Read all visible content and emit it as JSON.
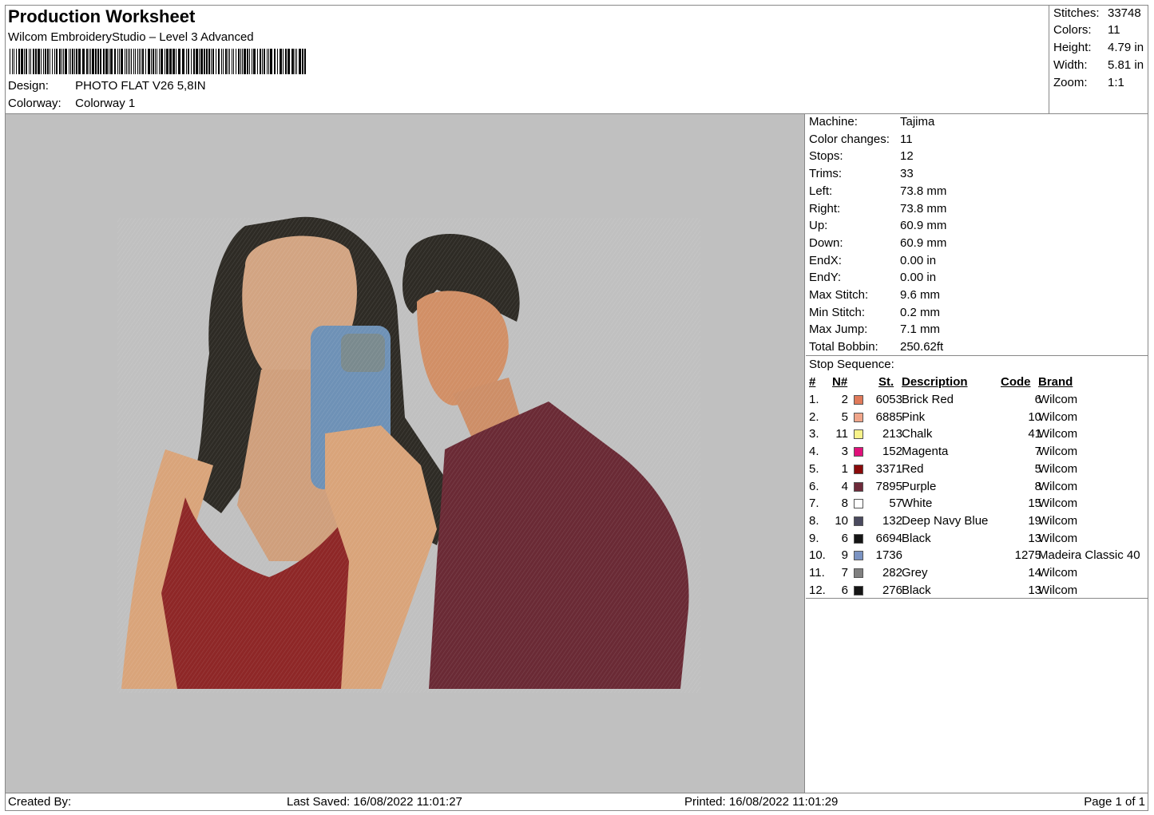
{
  "header": {
    "title": "Production Worksheet",
    "software": "Wilcom EmbroideryStudio – Level 3 Advanced",
    "design_label": "Design:",
    "design_value": "PHOTO FLAT V26 5,8IN",
    "colorway_label": "Colorway:",
    "colorway_value": "Colorway 1"
  },
  "stats": {
    "stitches_label": "Stitches:",
    "stitches_value": "33748",
    "colors_label": "Colors:",
    "colors_value": "11",
    "height_label": "Height:",
    "height_value": "4.79 in",
    "width_label": "Width:",
    "width_value": "5.81 in",
    "zoom_label": "Zoom:",
    "zoom_value": "1:1"
  },
  "machine": [
    {
      "label": "Machine:",
      "value": "Tajima"
    },
    {
      "label": "Color changes:",
      "value": "11"
    },
    {
      "label": "Stops:",
      "value": "12"
    },
    {
      "label": "Trims:",
      "value": "33"
    },
    {
      "label": "Left:",
      "value": "73.8 mm"
    },
    {
      "label": "Right:",
      "value": "73.8 mm"
    },
    {
      "label": "Up:",
      "value": "60.9 mm"
    },
    {
      "label": "Down:",
      "value": "60.9 mm"
    },
    {
      "label": "EndX:",
      "value": "0.00 in"
    },
    {
      "label": "EndY:",
      "value": "0.00 in"
    },
    {
      "label": "Max Stitch:",
      "value": "9.6 mm"
    },
    {
      "label": "Min Stitch:",
      "value": "0.2 mm"
    },
    {
      "label": "Max Jump:",
      "value": "7.1 mm"
    },
    {
      "label": "Total Bobbin:",
      "value": "250.62ft"
    }
  ],
  "stop_sequence": {
    "heading": "Stop Sequence:",
    "columns": {
      "idx": "#",
      "n": "N#",
      "st": "St.",
      "desc": "Description",
      "code": "Code",
      "brand": "Brand"
    },
    "rows": [
      {
        "idx": "1.",
        "n": "2",
        "color": "#e07a5a",
        "st": "6053",
        "desc": "Brick Red",
        "code": "6",
        "brand": "Wilcom"
      },
      {
        "idx": "2.",
        "n": "5",
        "color": "#f0a58a",
        "st": "6885",
        "desc": "Pink",
        "code": "10",
        "brand": "Wilcom"
      },
      {
        "idx": "3.",
        "n": "11",
        "color": "#f7f28a",
        "st": "213",
        "desc": "Chalk",
        "code": "41",
        "brand": "Wilcom"
      },
      {
        "idx": "4.",
        "n": "3",
        "color": "#e0107a",
        "st": "152",
        "desc": "Magenta",
        "code": "7",
        "brand": "Wilcom"
      },
      {
        "idx": "5.",
        "n": "1",
        "color": "#8a0a0a",
        "st": "3371",
        "desc": "Red",
        "code": "5",
        "brand": "Wilcom"
      },
      {
        "idx": "6.",
        "n": "4",
        "color": "#6e2a3a",
        "st": "7895",
        "desc": "Purple",
        "code": "8",
        "brand": "Wilcom"
      },
      {
        "idx": "7.",
        "n": "8",
        "color": "#ffffff",
        "st": "57",
        "desc": "White",
        "code": "15",
        "brand": "Wilcom"
      },
      {
        "idx": "8.",
        "n": "10",
        "color": "#4a4a5e",
        "st": "132",
        "desc": "Deep Navy Blue",
        "code": "19",
        "brand": "Wilcom"
      },
      {
        "idx": "9.",
        "n": "6",
        "color": "#151515",
        "st": "6694",
        "desc": "Black",
        "code": "13",
        "brand": "Wilcom"
      },
      {
        "idx": "10.",
        "n": "9",
        "color": "#7b93c2",
        "st": "1736",
        "desc": "",
        "code": "1275",
        "brand": "Madeira Classic 40"
      },
      {
        "idx": "11.",
        "n": "7",
        "color": "#808080",
        "st": "282",
        "desc": "Grey",
        "code": "14",
        "brand": "Wilcom"
      },
      {
        "idx": "12.",
        "n": "6",
        "color": "#151515",
        "st": "276",
        "desc": "Black",
        "code": "13",
        "brand": "Wilcom"
      }
    ]
  },
  "footer": {
    "created_by": "Created By:",
    "last_saved": "Last Saved: 16/08/2022 11:01:27",
    "printed": "Printed: 16/08/2022 11:01:29",
    "page": "Page 1 of 1"
  }
}
